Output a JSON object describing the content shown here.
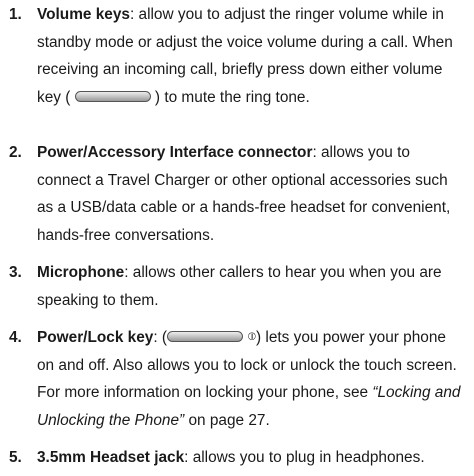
{
  "items": [
    {
      "number": "1.",
      "term": "Volume keys",
      "text_a": ": allow you to adjust the ringer volume while in standby mode or adjust the voice volume during a call. When receiving an incoming call, briefly press down either volume key (",
      "text_b": ") to mute the ring tone."
    },
    {
      "number": "2.",
      "term": "Power/Accessory Interface connector",
      "text_a": ": allows you to connect a Travel Charger or other optional accessories such as a USB/data cable or a hands-free headset for convenient, hands-free conversations."
    },
    {
      "number": "3.",
      "term": "Microphone",
      "text_a": ": allows other callers to hear you when you are speaking to them."
    },
    {
      "number": "4.",
      "term": "Power/Lock key",
      "text_a": ": (",
      "power_symbol": "⦶",
      "text_b": ") lets you power your phone on and off. Also allows you to lock or unlock the touch screen. For more information on locking your phone, see ",
      "ref": "“Locking and Unlocking the Phone”",
      "text_c": " on page 27."
    },
    {
      "number": "5.",
      "term": "3.5mm Headset jack",
      "text_a": ": allows you to plug in headphones."
    }
  ],
  "icons": {
    "volume_key": "side-key-icon",
    "power_key": "side-key-icon",
    "power_symbol": "power-icon"
  }
}
